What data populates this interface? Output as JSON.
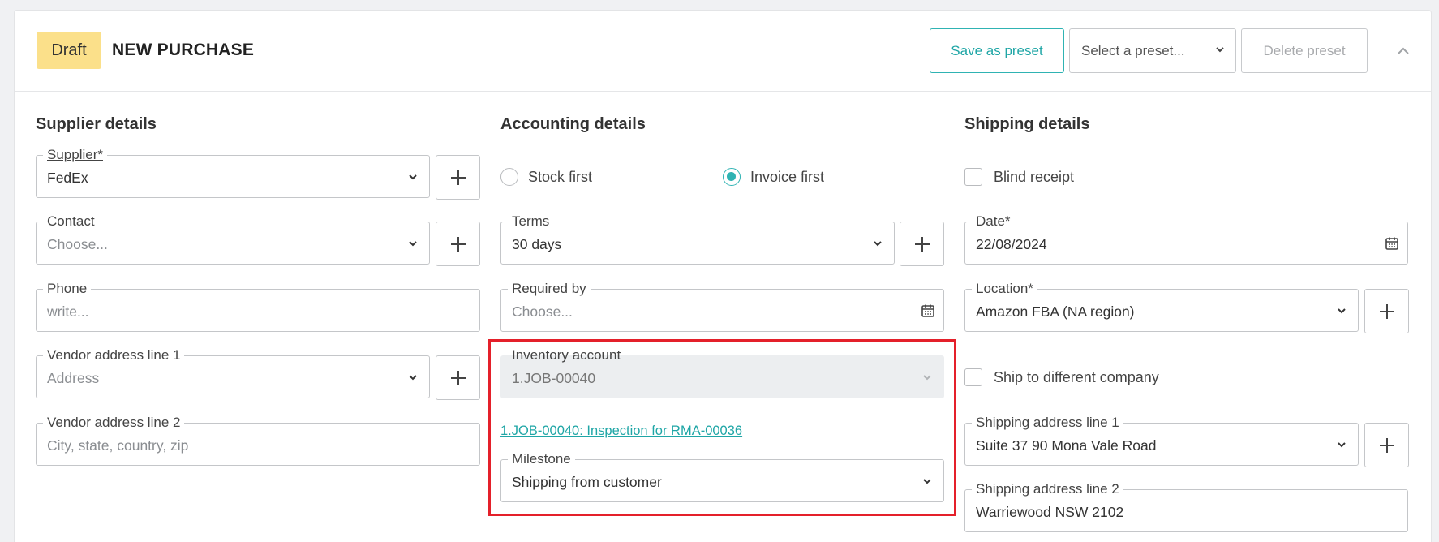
{
  "header": {
    "status_badge": "Draft",
    "title": "NEW PURCHASE",
    "save_preset_label": "Save as preset",
    "select_preset_placeholder": "Select a preset...",
    "delete_preset_label": "Delete preset"
  },
  "supplier": {
    "section_title": "Supplier details",
    "supplier_label": "Supplier*",
    "supplier_value": "FedEx",
    "contact_label": "Contact",
    "contact_placeholder": "Choose...",
    "phone_label": "Phone",
    "phone_placeholder": "write...",
    "vendor_line1_label": "Vendor address line 1",
    "vendor_line1_placeholder": "Address",
    "vendor_line2_label": "Vendor address line 2",
    "vendor_line2_placeholder": "City, state, country, zip"
  },
  "accounting": {
    "section_title": "Accounting details",
    "radio_stock_first": "Stock first",
    "radio_invoice_first": "Invoice first",
    "selected_radio": "Invoice first",
    "terms_label": "Terms",
    "terms_value": "30 days",
    "required_by_label": "Required by",
    "required_by_placeholder": "Choose...",
    "inventory_account_label": "Inventory account",
    "inventory_account_value": "1.JOB-00040",
    "job_link": "1.JOB-00040: Inspection for RMA-00036",
    "milestone_label": "Milestone",
    "milestone_value": "Shipping from customer"
  },
  "shipping": {
    "section_title": "Shipping details",
    "blind_receipt_label": "Blind receipt",
    "date_label": "Date*",
    "date_value": "22/08/2024",
    "location_label": "Location*",
    "location_value": "Amazon FBA (NA region)",
    "ship_to_different_label": "Ship to different company",
    "ship_line1_label": "Shipping address line 1",
    "ship_line1_value": "Suite 37 90 Mona Vale Road",
    "ship_line2_label": "Shipping address line 2",
    "ship_line2_value": "Warriewood NSW 2102"
  },
  "colors": {
    "accent": "#2fb3b3",
    "draft_badge": "#fbe08a",
    "highlight_border": "#e4202a"
  },
  "icons": [
    "chevron-down-icon",
    "chevron-up-icon",
    "plus-icon",
    "calendar-icon"
  ]
}
